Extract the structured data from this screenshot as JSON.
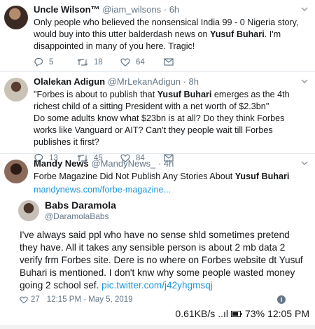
{
  "tweets": [
    {
      "name": "Uncle Wilson™",
      "handle": "@iam_wilsons",
      "time": "· 6h",
      "text_before": "Only people who believed the nonsensical India 99 - 0 Nigeria story, would buy into this utter balderdash news on ",
      "text_bold": "Yusuf Buhari",
      "text_after": ". I'm disappointed in many of you here. Tragic!",
      "replies": "5",
      "retweets": "18",
      "likes": "64"
    },
    {
      "name": "Olalekan Adigun",
      "handle": "@MrLekanAdigun",
      "time": "· 8h",
      "text_before": "\"Forbes is about to publish that ",
      "text_bold": "Yusuf Buhari",
      "text_after": " emerges as the 4th richest child of a sitting President with a net worth of $2.3bn\"",
      "text_line2": "Do some adults know what $23bn is at all? Do they think Forbes works like Vanguard or AIT? Can't they people wait till Forbes publishes it first?",
      "replies": "13",
      "retweets": "45",
      "likes": "84"
    },
    {
      "name": "Mandy News",
      "handle": "@MandyNews_",
      "time": "· 4h",
      "text_before": "Forbe Magazine Did Not Publish Any Stories About ",
      "text_bold": "Yusuf Buhari",
      "link": "mandynews.com/forbe-magazine..."
    }
  ],
  "embed": {
    "name": "Babs Daramola",
    "handle": "@DaramolaBabs",
    "text": "I've always said ppl who have no sense shld sometimes pretend they have. All it takes any sensible person is about 2 mb data 2 verify frm Forbes site. Dere is no where on Forbes website dt Yusuf Buhari is mentioned. I don't knw why some people wasted money going 2 school sef. ",
    "link": "pic.twitter.com/j42yhgmsqj",
    "likes": "27",
    "datetime": "12:15 PM - May 5, 2019",
    "info_icon": "i",
    "status_speed": "0.61KB/s",
    "status_network": "..ıl",
    "status_battery": "73%",
    "status_time": "12:05 PM"
  }
}
